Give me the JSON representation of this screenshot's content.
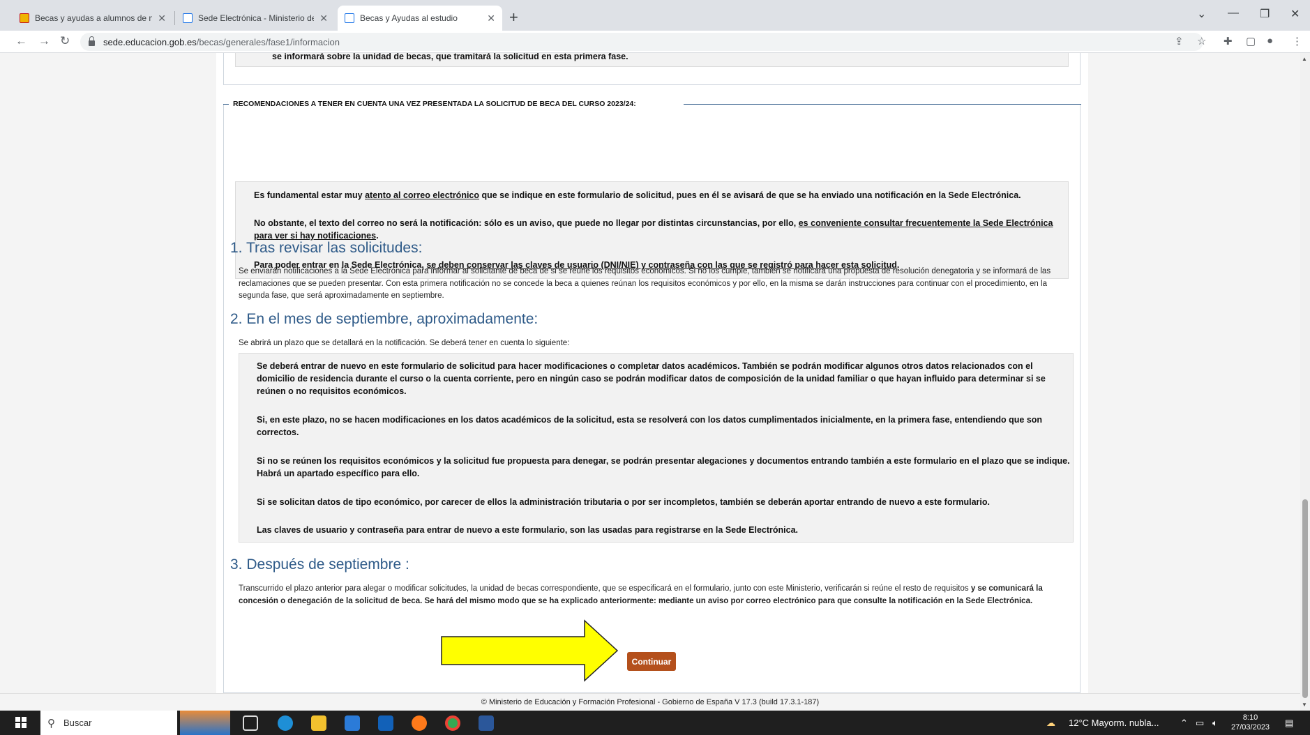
{
  "browser": {
    "tabs": [
      {
        "title": "Becas y ayudas a alumnos de nivel",
        "active": false
      },
      {
        "title": "Sede Electrónica - Ministerio de E",
        "active": false
      },
      {
        "title": "Becas y Ayudas al estudio",
        "active": true
      }
    ],
    "url_host": "sede.educacion.gob.es",
    "url_path": "/becas/generales/fase1/informacion"
  },
  "page": {
    "top_cut_text": "se informará sobre la unidad de becas, que tramitará la solicitud en esta primera fase.",
    "recommendations": {
      "legend": "RECOMENDACIONES A TENER EN CUENTA UNA VEZ PRESENTADA LA SOLICITUD DE BECA DEL CURSO 2023/24:",
      "p1": {
        "a": "Es fundamental estar muy ",
        "u": "atento al correo electrónico",
        "b": " que se indique en este formulario de solicitud, pues en él se avisará de que se ha enviado una notificación en la Sede Electrónica."
      },
      "p2": {
        "a": "No obstante, el texto del correo no será la notificación: sólo es un aviso, que puede no llegar por distintas circunstancias, por ello, ",
        "u": "es conveniente consultar frecuentemente la Sede Electrónica para ver si hay notificaciones",
        "b": "."
      },
      "p3": {
        "a": "Para poder entrar en la Sede Electrónica, ",
        "u": "se deben conservar las claves de usuario (DNI/NIE) y contraseña con las que se registró para hacer esta solicitud",
        "b": "."
      }
    },
    "section1": {
      "heading": "1. Tras revisar las solicitudes:",
      "text": "Se enviarán notificaciones a la Sede Electrónica para informar al solicitante de beca de si se reúne los requisitos económicos. Si no los cumple, también se notificará una propuesta de resolución denegatoria y se informará de las reclamaciones que se pueden presentar. Con esta primera notificación no se concede la beca a quienes reúnan los requisitos económicos y por ello, en la misma se darán instrucciones para continuar con el procedimiento, en la segunda fase, que será aproximadamente en septiembre."
    },
    "section2": {
      "heading": "2. En el mes de septiembre, aproximadamente:",
      "intro": "Se abrirá un plazo que se detallará en la notificación. Se deberá tener en cuenta lo siguiente:",
      "items": [
        "Se deberá entrar de nuevo en este formulario de solicitud para hacer modificaciones o completar datos académicos. También se podrán modificar algunos otros datos relacionados con el domicilio de residencia durante el curso o la cuenta corriente, pero en ningún caso se podrán modificar datos de composición de la unidad familiar o que hayan influido para determinar si se reúnen o no requisitos económicos.",
        "Si, en este plazo, no se hacen modificaciones en los datos académicos de la solicitud, esta se resolverá con los datos cumplimentados inicialmente, en la primera fase, entendiendo que son correctos.",
        "Si no se reúnen los requisitos económicos y la solicitud fue propuesta para denegar, se podrán presentar alegaciones y documentos entrando también a este formulario en el plazo que se indique. Habrá un apartado específico para ello.",
        "Si se solicitan datos de tipo económico, por carecer de ellos la administración tributaria o por ser incompletos, también se deberán aportar entrando de nuevo a este formulario.",
        "Las claves de usuario y contraseña para entrar de nuevo a este formulario, son las usadas para registrarse en la Sede Electrónica."
      ]
    },
    "section3": {
      "heading": "3. Después de septiembre :",
      "text_normal": "Transcurrido el plazo anterior para alegar o modificar solicitudes, la unidad de becas correspondiente, que se especificará en el formulario, junto con este Ministerio, verificarán si reúne el resto de requisitos",
      "text_bold": " y se comunicará la concesión o denegación de la solicitud de beca. Se hará del mismo modo que se ha explicado anteriormente: mediante un aviso por correo electrónico para que consulte la notificación en la Sede Electrónica."
    },
    "continue_label": "Continuar",
    "footer": "© Ministerio de Educación y Formación Profesional - Gobierno de España V 17.3 (build 17.3.1-187)",
    "arrow_color": "#ffff00"
  },
  "taskbar": {
    "search_placeholder": "Buscar",
    "weather": "12°C  Mayorm. nubla...",
    "time": "8:10",
    "date": "27/03/2023"
  }
}
